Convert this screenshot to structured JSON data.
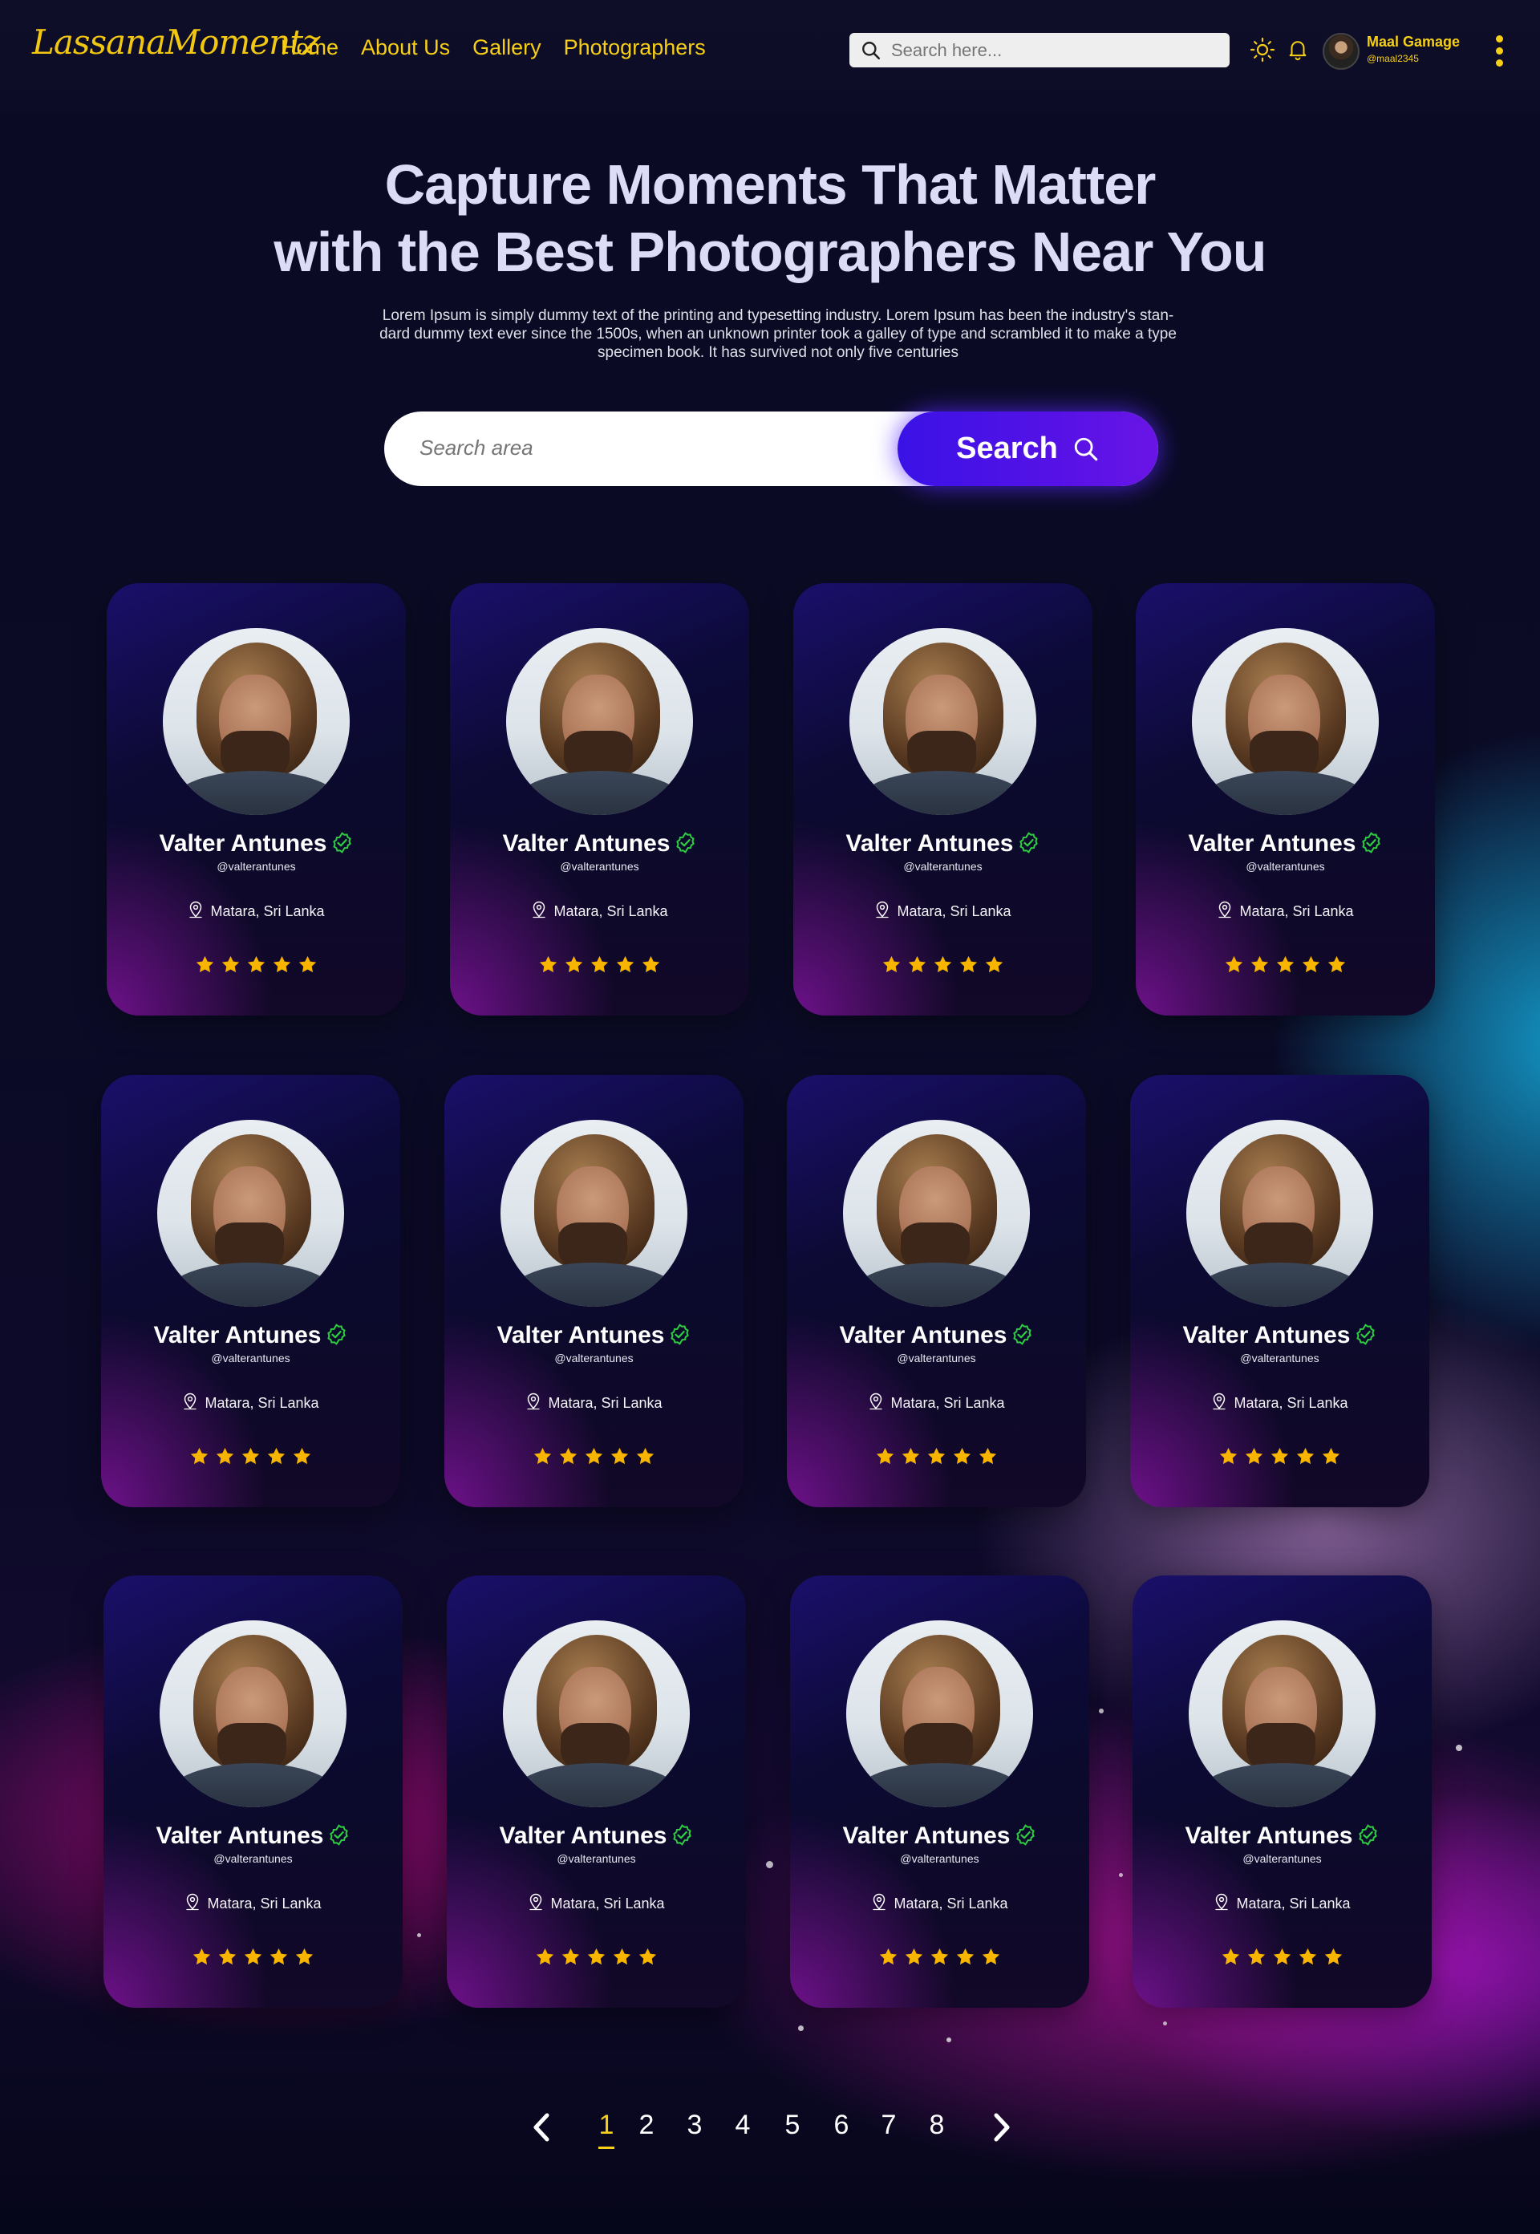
{
  "brand": {
    "logo_text": "LassanaMomentz"
  },
  "nav": {
    "items": [
      "Home",
      "About Us",
      "Gallery",
      "Photographers"
    ]
  },
  "header_search": {
    "placeholder": "Search here..."
  },
  "user": {
    "name": "Maal Gamage",
    "handle": "@maal2345"
  },
  "hero": {
    "title_line1": "Capture Moments That Matter",
    "title_line2": "with the Best Photographers Near You",
    "description_line1": "Lorem Ipsum is simply dummy text of the printing and typesetting industry. Lorem Ipsum has been the industry's stan-",
    "description_line2": "dard dummy text ever since the 1500s, when an unknown printer took a galley of type and scrambled it to make a type",
    "description_line3": "specimen book. It has survived not only five centuries"
  },
  "area_search": {
    "placeholder": "Search area",
    "button_label": "Search"
  },
  "photographers": [
    {
      "name": "Valter Antunes",
      "handle": "@valterantunes",
      "location": "Matara, Sri Lanka",
      "rating": 5
    },
    {
      "name": "Valter Antunes",
      "handle": "@valterantunes",
      "location": "Matara, Sri Lanka",
      "rating": 5
    },
    {
      "name": "Valter Antunes",
      "handle": "@valterantunes",
      "location": "Matara, Sri Lanka",
      "rating": 5
    },
    {
      "name": "Valter Antunes",
      "handle": "@valterantunes",
      "location": "Matara, Sri Lanka",
      "rating": 5
    },
    {
      "name": "Valter Antunes",
      "handle": "@valterantunes",
      "location": "Matara, Sri Lanka",
      "rating": 5
    },
    {
      "name": "Valter Antunes",
      "handle": "@valterantunes",
      "location": "Matara, Sri Lanka",
      "rating": 5
    },
    {
      "name": "Valter Antunes",
      "handle": "@valterantunes",
      "location": "Matara, Sri Lanka",
      "rating": 5
    },
    {
      "name": "Valter Antunes",
      "handle": "@valterantunes",
      "location": "Matara, Sri Lanka",
      "rating": 5
    },
    {
      "name": "Valter Antunes",
      "handle": "@valterantunes",
      "location": "Matara, Sri Lanka",
      "rating": 5
    },
    {
      "name": "Valter Antunes",
      "handle": "@valterantunes",
      "location": "Matara, Sri Lanka",
      "rating": 5
    },
    {
      "name": "Valter Antunes",
      "handle": "@valterantunes",
      "location": "Matara, Sri Lanka",
      "rating": 5
    },
    {
      "name": "Valter Antunes",
      "handle": "@valterantunes",
      "location": "Matara, Sri Lanka",
      "rating": 5
    }
  ],
  "pagination": {
    "pages": [
      "1",
      "2",
      "3",
      "4",
      "5",
      "6",
      "7",
      "8"
    ],
    "current": "1"
  },
  "colors": {
    "accent": "#f6cf16",
    "button": "#4a12e6",
    "verified": "#2ecc40",
    "star": "#f7b500"
  }
}
